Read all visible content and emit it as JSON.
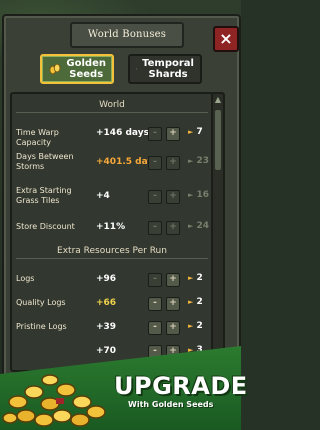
{
  "window": {
    "title": "World Bonuses",
    "close_label": "×"
  },
  "tabs": [
    {
      "label_line1": "Golden",
      "label_line2": "Seeds",
      "active": true,
      "icon": "golden-seeds-icon"
    },
    {
      "label_line1": "Temporal",
      "label_line2": "Shards",
      "active": false,
      "icon": "temporal-shards-icon"
    }
  ],
  "sections": {
    "world": "World",
    "extra_resources": "Extra Resources Per Run"
  },
  "world_rows": [
    {
      "label": "Time Warp Capacity",
      "value": "+146 days",
      "value_color": "white",
      "level": "7",
      "enabled": true
    },
    {
      "label": "Days Between Storms",
      "value": "+401.5 days",
      "value_color": "orange",
      "level": "23",
      "enabled": false
    },
    {
      "label": "Extra Starting Grass Tiles",
      "value": "+4",
      "value_color": "white",
      "level": "16",
      "enabled": false
    },
    {
      "label": "Store Discount",
      "value": "+11%",
      "value_color": "white",
      "level": "24",
      "enabled": false
    }
  ],
  "resource_rows": [
    {
      "label": "Logs",
      "value": "+96",
      "value_color": "white",
      "level": "2",
      "enabled": true
    },
    {
      "label": "Quality Logs",
      "value": "+66",
      "value_color": "yellow",
      "level": "2",
      "enabled": true
    },
    {
      "label": "Pristine Logs",
      "value": "+39",
      "value_color": "white",
      "level": "2",
      "enabled": true
    },
    {
      "label": "",
      "value": "+70",
      "value_color": "white",
      "level": "3",
      "enabled": true
    }
  ],
  "controls": {
    "minus": "-",
    "plus": "+",
    "level_arrow": "►"
  },
  "banner": {
    "title": "UPGRADE",
    "subtitle": "With Golden Seeds"
  },
  "colors": {
    "panel": "#3b4036",
    "active_tab": "#4d6a3a",
    "accent_gold": "#f2c23b",
    "close_red": "#8e2424",
    "banner_green": "#2b7b2f"
  }
}
